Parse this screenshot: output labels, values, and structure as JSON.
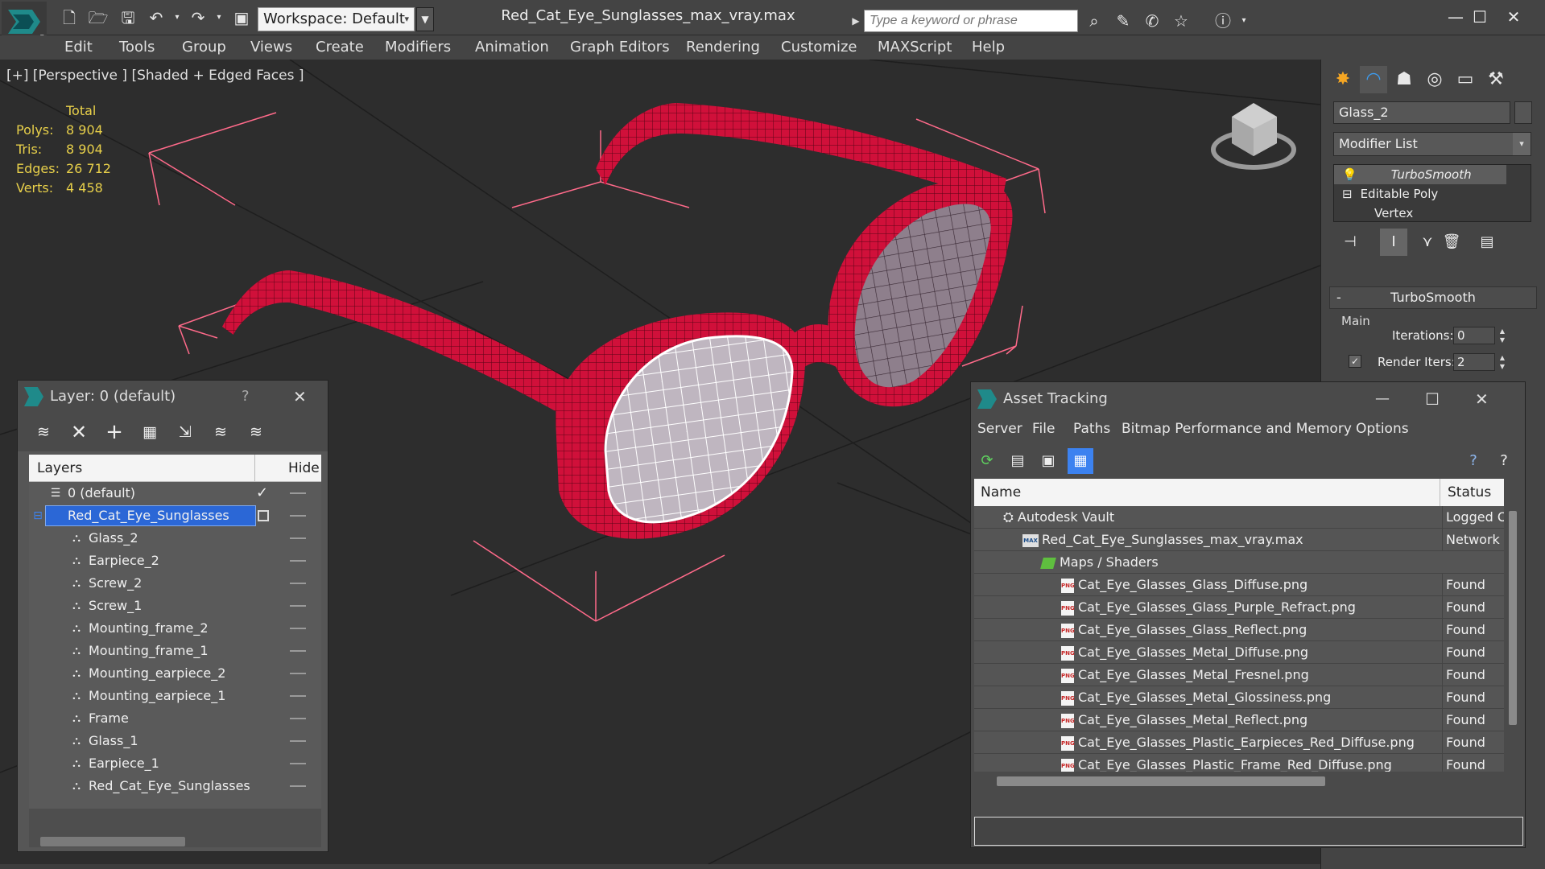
{
  "app": {
    "file_title": "Red_Cat_Eye_Sunglasses_max_vray.max",
    "workspace": "Workspace: Default",
    "search_placeholder": "Type a keyword or phrase"
  },
  "menu": [
    "Edit",
    "Tools",
    "Group",
    "Views",
    "Create",
    "Modifiers",
    "Animation",
    "Graph Editors",
    "Rendering",
    "Customize",
    "MAXScript",
    "Help"
  ],
  "viewport": {
    "label": "[+] [Perspective ] [Shaded + Edged Faces ]",
    "stats_header": "Total",
    "stats": [
      {
        "label": "Polys:",
        "value": "8 904"
      },
      {
        "label": "Tris:",
        "value": "8 904"
      },
      {
        "label": "Edges:",
        "value": "26 712"
      },
      {
        "label": "Verts:",
        "value": "4 458"
      }
    ]
  },
  "command_panel": {
    "object_name": "Glass_2",
    "modifier_list": "Modifier List",
    "stack": [
      "TurboSmooth",
      "Editable Poly",
      "Vertex"
    ],
    "rollout_title": "TurboSmooth",
    "rollout_minus": "-",
    "group_main": "Main",
    "iterations_label": "Iterations:",
    "iterations_value": "0",
    "render_iters_label": "Render Iters:",
    "render_iters_value": "2"
  },
  "layer_window": {
    "title": "Layer: 0 (default)",
    "help": "?",
    "col_layers": "Layers",
    "col_hide": "Hide",
    "rows": [
      {
        "name": "0 (default)",
        "indent": 0
      },
      {
        "name": "Red_Cat_Eye_Sunglasses",
        "indent": 0
      },
      {
        "name": "Glass_2",
        "indent": 1
      },
      {
        "name": "Earpiece_2",
        "indent": 1
      },
      {
        "name": "Screw_2",
        "indent": 1
      },
      {
        "name": "Screw_1",
        "indent": 1
      },
      {
        "name": "Mounting_frame_2",
        "indent": 1
      },
      {
        "name": "Mounting_frame_1",
        "indent": 1
      },
      {
        "name": "Mounting_earpiece_2",
        "indent": 1
      },
      {
        "name": "Mounting_earpiece_1",
        "indent": 1
      },
      {
        "name": "Frame",
        "indent": 1
      },
      {
        "name": "Glass_1",
        "indent": 1
      },
      {
        "name": "Earpiece_1",
        "indent": 1
      },
      {
        "name": "Red_Cat_Eye_Sunglasses",
        "indent": 1
      }
    ]
  },
  "asset_window": {
    "title": "Asset Tracking",
    "menu": [
      "Server",
      "File",
      "Paths",
      "Bitmap Performance and Memory",
      "Options"
    ],
    "col_name": "Name",
    "col_status": "Status",
    "rows": [
      {
        "name": "Autodesk Vault",
        "status": "Logged Out",
        "kind": "vault"
      },
      {
        "name": "Red_Cat_Eye_Sunglasses_max_vray.max",
        "status": "Network",
        "kind": "max"
      },
      {
        "name": "Maps / Shaders",
        "status": "",
        "kind": "maps"
      },
      {
        "name": "Cat_Eye_Glasses_Glass_Diffuse.png",
        "status": "Found",
        "kind": "png"
      },
      {
        "name": "Cat_Eye_Glasses_Glass_Purple_Refract.png",
        "status": "Found",
        "kind": "png"
      },
      {
        "name": "Cat_Eye_Glasses_Glass_Reflect.png",
        "status": "Found",
        "kind": "png"
      },
      {
        "name": "Cat_Eye_Glasses_Metal_Diffuse.png",
        "status": "Found",
        "kind": "png"
      },
      {
        "name": "Cat_Eye_Glasses_Metal_Fresnel.png",
        "status": "Found",
        "kind": "png"
      },
      {
        "name": "Cat_Eye_Glasses_Metal_Glossiness.png",
        "status": "Found",
        "kind": "png"
      },
      {
        "name": "Cat_Eye_Glasses_Metal_Reflect.png",
        "status": "Found",
        "kind": "png"
      },
      {
        "name": "Cat_Eye_Glasses_Plastic_Earpieces_Red_Diffuse.png",
        "status": "Found",
        "kind": "png"
      },
      {
        "name": "Cat_Eye_Glasses_Plastic_Frame_Red_Diffuse.png",
        "status": "Found",
        "kind": "png"
      }
    ]
  },
  "colors": {
    "frame_red": "#d0103a",
    "accent_blue": "#3c82f0",
    "selection": "#2b67d6",
    "stat_yellow": "#e8d04a",
    "bbox_pink": "#ff6a8a"
  },
  "icons": {
    "png_badge": "PNG"
  }
}
